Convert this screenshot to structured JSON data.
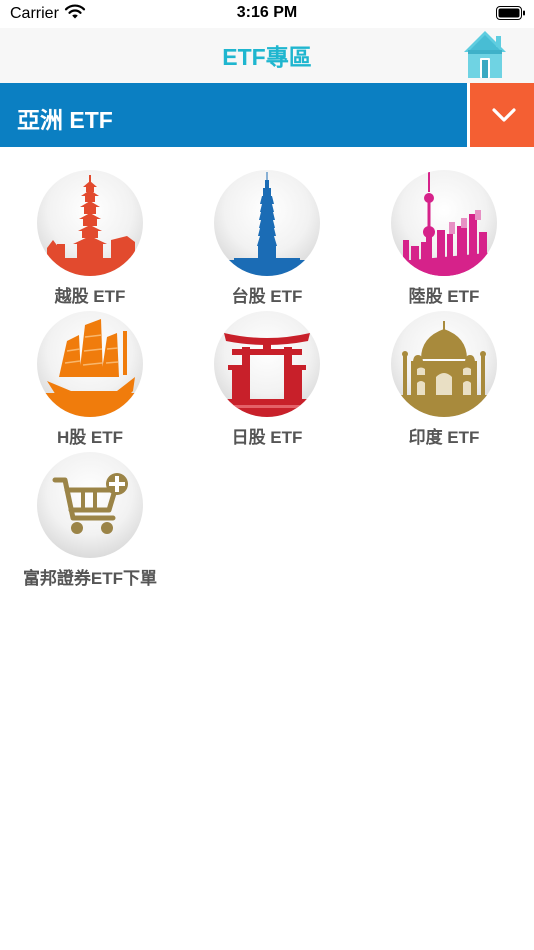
{
  "status_bar": {
    "carrier": "Carrier",
    "time": "3:16 PM"
  },
  "nav": {
    "title": "ETF專區",
    "home_icon": "house-icon"
  },
  "category": {
    "title": "亞洲 ETF",
    "dropdown_icon": "chevron-down-icon"
  },
  "colors": {
    "nav_title": "#1fb6cf",
    "category_bar": "#0b7fc2",
    "dropdown": "#f45f33",
    "label": "#555555"
  },
  "tiles": [
    {
      "label": "越股 ETF",
      "icon": "pagoda-icon",
      "color": "#e24a2e"
    },
    {
      "label": "台股 ETF",
      "icon": "taipei-101-icon",
      "color": "#1b6cb5"
    },
    {
      "label": "陸股 ETF",
      "icon": "shanghai-skyline-icon",
      "color": "#d6228a"
    },
    {
      "label": "H股 ETF",
      "icon": "junk-boat-icon",
      "color": "#f07c0c"
    },
    {
      "label": "日股 ETF",
      "icon": "torii-gate-icon",
      "color": "#c8202a"
    },
    {
      "label": "印度 ETF",
      "icon": "taj-mahal-icon",
      "color": "#a88a3c"
    },
    {
      "label": "富邦證券ETF下單",
      "icon": "cart-plus-icon",
      "color": "#9b8447"
    }
  ]
}
